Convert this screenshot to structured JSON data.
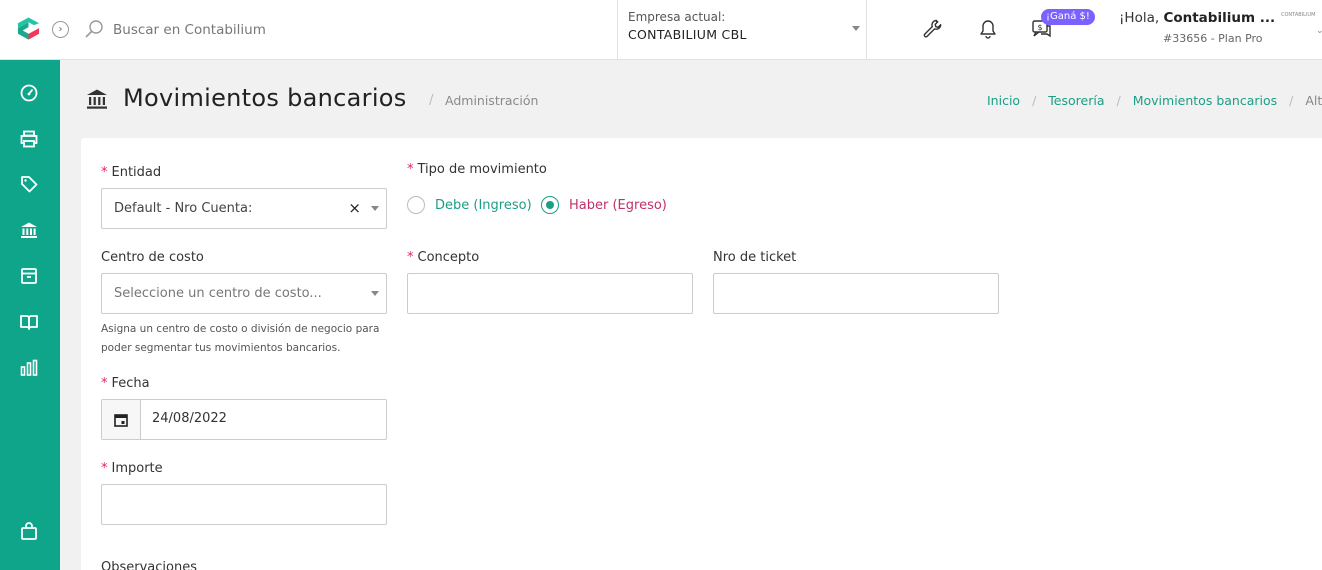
{
  "topbar": {
    "search_placeholder": "Buscar en Contabilium",
    "company_label": "Empresa actual:",
    "company_value": "CONTABILIUM CBL",
    "promo_badge": "¡Ganá $!",
    "greeting_prefix": "¡Hola, ",
    "user_name": "Contabilium ...",
    "plan": "#33656 - Plan Pro",
    "mini_logo_text": "CONTABILIUM"
  },
  "sidebar": {
    "items": [
      {
        "icon": "dashboard-gauge-icon"
      },
      {
        "icon": "printer-icon"
      },
      {
        "icon": "tag-icon"
      },
      {
        "icon": "bank-icon"
      },
      {
        "icon": "box-icon"
      },
      {
        "icon": "book-icon"
      },
      {
        "icon": "bar-chart-icon"
      },
      {
        "icon": "shopping-bag-icon"
      }
    ]
  },
  "page": {
    "title": "Movimientos bancarios",
    "separator": "/",
    "subtitle": "Administración",
    "breadcrumb": {
      "home": "Inicio",
      "section": "Tesorería",
      "page": "Movimientos bancarios",
      "current": "Alta"
    }
  },
  "form": {
    "entidad": {
      "label": "Entidad",
      "value": "Default - Nro Cuenta:",
      "clear": "×"
    },
    "tipo": {
      "label": "Tipo de movimiento",
      "option_debe": "Debe (Ingreso)",
      "option_haber": "Haber (Egreso)",
      "selected": "haber"
    },
    "centro_costo": {
      "label": "Centro de costo",
      "placeholder": "Seleccione un centro de costo...",
      "help": "Asigna un centro de costo o división de negocio para poder segmentar tus movimientos bancarios."
    },
    "concepto": {
      "label": "Concepto",
      "value": ""
    },
    "ticket": {
      "label": "Nro de ticket",
      "value": ""
    },
    "fecha": {
      "label": "Fecha",
      "value": "24/08/2022"
    },
    "importe": {
      "label": "Importe",
      "value": ""
    },
    "observaciones": {
      "label": "Observaciones"
    },
    "required_marker": "*"
  },
  "colors": {
    "brand": "#0fa58a",
    "link": "#1b9e86",
    "required": "#e0245e",
    "radio_haber_label": "#c0306a",
    "radio_debe_label": "#1b9e86",
    "badge": "#7b61ff"
  }
}
